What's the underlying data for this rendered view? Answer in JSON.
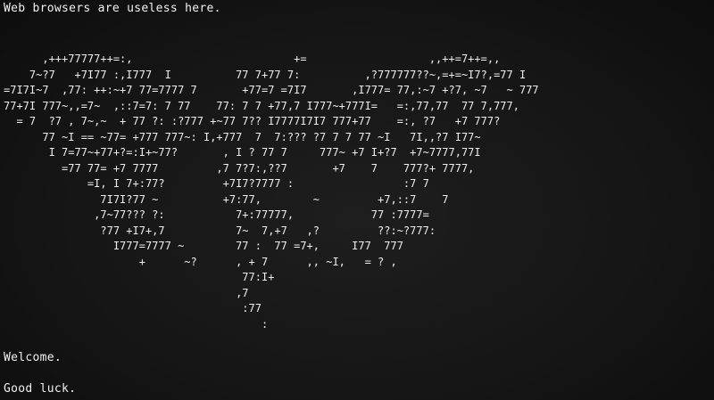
{
  "terminal": {
    "header": "Web browsers are useless here.",
    "ascii_art": [
      "      ,+++77777++=:,                         +=                   ,,++=7++=,,",
      "    7~?7   +7I77 :,I777  I          77 7+77 7:          ,?777777??~,=+=~I7?,=77 I",
      "=7I7I~7  ,77: ++:~+7 77=7777 7       +77=7 =7I7       ,I777= 77,:~7 +?7, ~7   ~ 777",
      "77+7I 777~,,=7~  ,::7=7: 7 77    77: 7 7 +77,7 I777~+777I=   =:,77,77  77 7,777,",
      "  = 7  ?7 , 7~,~  + 77 ?: :?777 +~77 7?? I7777I7I7 777+77    =:, ?7   +7 777?",
      "      77 ~I == ~77= +777 777~: I,+777  7  7:??? ?7 7 7 77 ~I   7I,,?7 I77~",
      "       I 7=77~+77+?=:I+~77?       , I ? 77 7     777~ +7 I+?7  +7~7777,77I",
      "         =77 77= +7 7777         ,7 7?7:,??7       +7    7    777?+ 7777,",
      "             =I, I 7+:77?         +7I7?7777 :                 :7 7",
      "               7I7I?77 ~          +7:77,        ~         +7,::7    7",
      "              ,7~77??? ?:           7+:77777,            77 :7777=",
      "               ?77 +I7+,7           7~  7,+7   ,?         ??:~?777:",
      "                 I777=7777 ~        77 :  77 =7+,     I77  777",
      "                     +      ~?      , + 7      ,, ~I,   = ? ,",
      "                                     77:I+",
      "                                    ,7",
      "                                     :77",
      "                                        :"
    ],
    "welcome": "Welcome.",
    "goodluck": "Good luck."
  }
}
